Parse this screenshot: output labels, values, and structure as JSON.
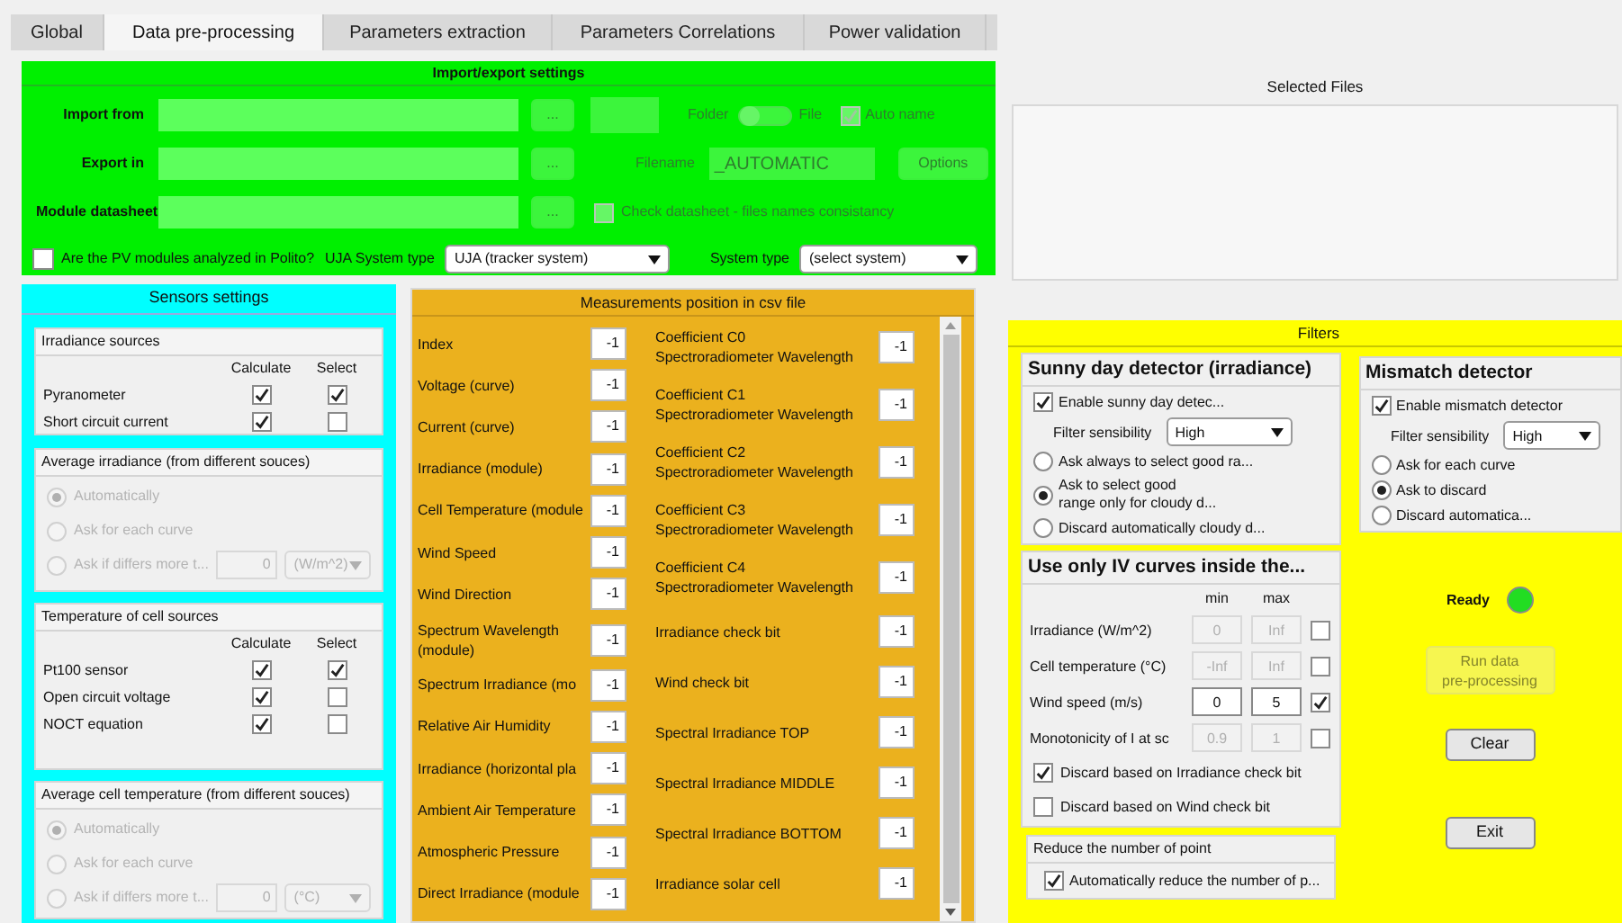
{
  "tabs": [
    {
      "label": "Global",
      "selected": false
    },
    {
      "label": "Data pre-processing",
      "selected": true
    },
    {
      "label": "Parameters extraction",
      "selected": false
    },
    {
      "label": "Parameters Correlations",
      "selected": false
    },
    {
      "label": "Power validation",
      "selected": false
    }
  ],
  "import_export": {
    "title": "Import/export settings",
    "import_from": {
      "label": "Import from",
      "browse": {
        "label": "...",
        "disabled": true
      },
      "toggle": {
        "left": "Folder",
        "right": "File",
        "on": false,
        "disabled": true
      },
      "auto_name": {
        "label": "Auto name",
        "checked": true,
        "disabled": true
      }
    },
    "export_in": {
      "label": "Export in",
      "browse": {
        "label": "...",
        "disabled": true
      },
      "filename_label": "Filename",
      "filename": "_AUTOMATIC",
      "options": {
        "label": "Options",
        "disabled": true
      }
    },
    "module_datasheet": {
      "label": "Module datasheet",
      "browse": {
        "label": "...",
        "disabled": true
      },
      "check": {
        "label": "Check datasheet - files names consistancy",
        "checked": false,
        "disabled": true
      }
    },
    "polito": {
      "label": "Are the PV modules analyzed in Polito?",
      "checked": false
    },
    "uja_system": {
      "label": "UJA System type",
      "value": "UJA (tracker system)"
    },
    "system_type": {
      "label": "System type",
      "value": "(select system)"
    }
  },
  "selected_files": {
    "title": "Selected Files"
  },
  "sensors": {
    "title": "Sensors settings",
    "irradiance_sources": {
      "title": "Irradiance sources",
      "columns": [
        "Calculate",
        "Select"
      ],
      "rows": [
        {
          "label": "Pyranometer",
          "calculate": true,
          "select": true
        },
        {
          "label": "Short circuit current",
          "calculate": true,
          "select": false
        }
      ]
    },
    "average_irradiance": {
      "title": "Average irradiance (from different souces)",
      "disabled": true,
      "options": [
        {
          "label": "Automatically",
          "selected": true
        },
        {
          "label": "Ask for each curve",
          "selected": false
        },
        {
          "label": "Ask if differs more t...",
          "selected": false
        }
      ],
      "threshold": "0",
      "unit": "(W/m^2)"
    },
    "cell_temperature_sources": {
      "title": "Temperature of cell sources",
      "columns": [
        "Calculate",
        "Select"
      ],
      "rows": [
        {
          "label": "Pt100 sensor",
          "calculate": true,
          "select": true
        },
        {
          "label": "Open circuit voltage",
          "calculate": true,
          "select": false
        },
        {
          "label": "NOCT equation",
          "calculate": true,
          "select": false
        }
      ]
    },
    "average_cell_temperature": {
      "title": "Average cell temperature (from different souces)",
      "disabled": true,
      "options": [
        {
          "label": "Automatically",
          "selected": true
        },
        {
          "label": "Ask for each curve",
          "selected": false
        },
        {
          "label": "Ask if differs more t...",
          "selected": false
        }
      ],
      "threshold": "0",
      "unit": "(°C)"
    }
  },
  "measurements": {
    "title": "Measurements position in csv file",
    "left": [
      {
        "label": "Index",
        "value": "-1"
      },
      {
        "label": "Voltage (curve)",
        "value": "-1"
      },
      {
        "label": "Current (curve)",
        "value": "-1"
      },
      {
        "label": "Irradiance (module)",
        "value": "-1"
      },
      {
        "label": "Cell Temperature (module",
        "value": "-1"
      },
      {
        "label": "Wind Speed",
        "value": "-1"
      },
      {
        "label": "Wind Direction",
        "value": "-1"
      },
      {
        "label": "Spectrum Wavelength\n(module)",
        "value": "-1"
      },
      {
        "label": "Spectrum Irradiance (mo",
        "value": "-1"
      },
      {
        "label": "Relative Air Humidity",
        "value": "-1"
      },
      {
        "label": "Irradiance (horizontal pla",
        "value": "-1"
      },
      {
        "label": "Ambient Air Temperature",
        "value": "-1"
      },
      {
        "label": "Atmospheric Pressure",
        "value": "-1"
      },
      {
        "label": "Direct Irradiance (module",
        "value": "-1"
      }
    ],
    "right": [
      {
        "label": "Coefficient C0\nSpectroradiometer Wavelength",
        "value": "-1"
      },
      {
        "label": "Coefficient C1\nSpectroradiometer Wavelength",
        "value": "-1"
      },
      {
        "label": "Coefficient C2\nSpectroradiometer Wavelength",
        "value": "-1"
      },
      {
        "label": "Coefficient C3\nSpectroradiometer Wavelength",
        "value": "-1"
      },
      {
        "label": "Coefficient C4\nSpectroradiometer Wavelength",
        "value": "-1"
      },
      {
        "label": "Irradiance check bit",
        "value": "-1"
      },
      {
        "label": "Wind check bit",
        "value": "-1"
      },
      {
        "label": "Spectral Irradiance TOP",
        "value": "-1"
      },
      {
        "label": "Spectral Irradiance MIDDLE",
        "value": "-1"
      },
      {
        "label": "Spectral Irradiance BOTTOM",
        "value": "-1"
      },
      {
        "label": "Irradiance solar cell",
        "value": "-1"
      }
    ]
  },
  "filters": {
    "title": "Filters",
    "sunny_day": {
      "title": "Sunny day detector (irradiance)",
      "enable": {
        "label": "Enable sunny day detec...",
        "checked": true
      },
      "sensibility_label": "Filter sensibility",
      "sensibility": "High",
      "options": [
        {
          "label": "Ask always to select good ra...",
          "selected": false
        },
        {
          "label": "Ask to select good\nrange only for cloudy d...",
          "selected": true
        },
        {
          "label": "Discard automatically cloudy d...",
          "selected": false
        }
      ]
    },
    "iv_limits": {
      "title": "Use only IV curves inside the...",
      "min_label": "min",
      "max_label": "max",
      "rows": [
        {
          "label": "Irradiance (W/m^2)",
          "min": "0",
          "max": "Inf",
          "checked": false
        },
        {
          "label": "Cell temperature (°C)",
          "min": "-Inf",
          "max": "Inf",
          "checked": false
        },
        {
          "label": "Wind speed (m/s)",
          "min": "0",
          "max": "5",
          "checked": true
        },
        {
          "label": "Monotonicity of I at sc",
          "min": "0.9",
          "max": "1",
          "checked": false
        }
      ],
      "checks": [
        {
          "label": "Discard based on Irradiance check bit",
          "checked": true
        },
        {
          "label": "Discard based on Wind check bit",
          "checked": false
        }
      ]
    },
    "reduce_points": {
      "title": "Reduce the number of point",
      "check": {
        "label": "Automatically reduce the number of p...",
        "checked": true
      }
    },
    "mismatch": {
      "title": "Mismatch detector",
      "enable": {
        "label": "Enable mismatch detector",
        "checked": true
      },
      "sensibility_label": "Filter sensibility",
      "sensibility": "High",
      "options": [
        {
          "label": "Ask for each curve",
          "selected": false
        },
        {
          "label": "Ask to discard",
          "selected": true
        },
        {
          "label": "Discard automatica...",
          "selected": false
        }
      ]
    },
    "status": {
      "label": "Ready",
      "color": "#22dd22"
    },
    "run_button": {
      "label": "Run data\npre-processing",
      "disabled": true
    },
    "clear_button": {
      "label": "Clear"
    },
    "exit_button": {
      "label": "Exit"
    }
  }
}
